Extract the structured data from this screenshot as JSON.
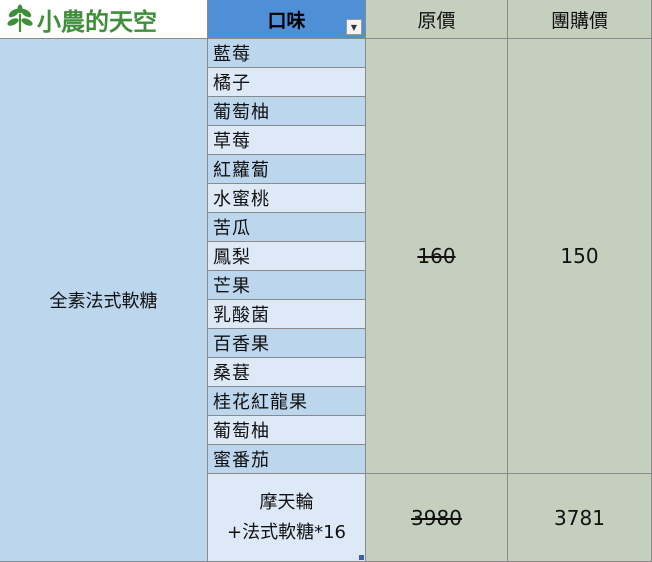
{
  "header": {
    "brand": "小農的天空",
    "flavor_col": "口味",
    "price_col": "原價",
    "group_col": "團購價"
  },
  "product": {
    "name": "全素法式軟糖"
  },
  "flavors": [
    "藍莓",
    "橘子",
    "葡萄柚",
    "草莓",
    "紅蘿蔔",
    "水蜜桃",
    "苦瓜",
    "鳳梨",
    "芒果",
    "乳酸菌",
    "百香果",
    "桑葚",
    "桂花紅龍果",
    "葡萄柚",
    "蜜番茄"
  ],
  "single": {
    "original": "160",
    "group": "150"
  },
  "combo": {
    "line1": "摩天輪",
    "line2": "+法式軟糖*16",
    "original": "3980",
    "group": "3781"
  },
  "colors": {
    "header_blue": "#4f8fd6",
    "row_dark": "#bcd6ee",
    "row_light": "#dde9f6",
    "price_bg": "#c4cfbe",
    "brand_green": "#3f8f3a"
  },
  "icons": {
    "logo": "leaf-icon",
    "filter": "filter-dropdown-icon"
  }
}
